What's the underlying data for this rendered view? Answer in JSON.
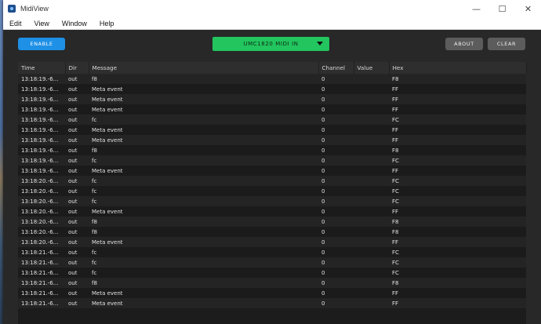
{
  "window": {
    "title": "MidiView"
  },
  "window_controls": {
    "minimize": "—",
    "maximize": "☐",
    "close": "✕"
  },
  "menu": [
    "Edit",
    "View",
    "Window",
    "Help"
  ],
  "toolbar": {
    "enable_label": "ENABLE",
    "device_label": "UMC1820 MIDI IN",
    "about_label": "ABOUT",
    "clear_label": "CLEAR"
  },
  "colors": {
    "enable": "#1e90e6",
    "device": "#22c55e",
    "background": "#282828"
  },
  "table": {
    "columns": [
      "Time",
      "Dir",
      "Message",
      "Channel",
      "Value",
      "Hex"
    ],
    "rows": [
      [
        "13:18:19.-6...",
        "out",
        "f8",
        "0",
        "",
        "F8"
      ],
      [
        "13:18:19.-6...",
        "out",
        "Meta event",
        "0",
        "",
        "FF"
      ],
      [
        "13:18:19.-6...",
        "out",
        "Meta event",
        "0",
        "",
        "FF"
      ],
      [
        "13:18:19.-6...",
        "out",
        "Meta event",
        "0",
        "",
        "FF"
      ],
      [
        "13:18:19.-6...",
        "out",
        "fc",
        "0",
        "",
        "FC"
      ],
      [
        "13:18:19.-6...",
        "out",
        "Meta event",
        "0",
        "",
        "FF"
      ],
      [
        "13:18:19.-6...",
        "out",
        "Meta event",
        "0",
        "",
        "FF"
      ],
      [
        "13:18:19.-6...",
        "out",
        "f8",
        "0",
        "",
        "F8"
      ],
      [
        "13:18:19.-6...",
        "out",
        "fc",
        "0",
        "",
        "FC"
      ],
      [
        "13:18:19.-6...",
        "out",
        "Meta event",
        "0",
        "",
        "FF"
      ],
      [
        "13:18:20.-6...",
        "out",
        "fc",
        "0",
        "",
        "FC"
      ],
      [
        "13:18:20.-6...",
        "out",
        "fc",
        "0",
        "",
        "FC"
      ],
      [
        "13:18:20.-6...",
        "out",
        "fc",
        "0",
        "",
        "FC"
      ],
      [
        "13:18:20.-6...",
        "out",
        "Meta event",
        "0",
        "",
        "FF"
      ],
      [
        "13:18:20.-6...",
        "out",
        "f8",
        "0",
        "",
        "F8"
      ],
      [
        "13:18:20.-6...",
        "out",
        "f8",
        "0",
        "",
        "F8"
      ],
      [
        "13:18:20.-6...",
        "out",
        "Meta event",
        "0",
        "",
        "FF"
      ],
      [
        "13:18:21.-6...",
        "out",
        "fc",
        "0",
        "",
        "FC"
      ],
      [
        "13:18:21.-6...",
        "out",
        "fc",
        "0",
        "",
        "FC"
      ],
      [
        "13:18:21.-6...",
        "out",
        "fc",
        "0",
        "",
        "FC"
      ],
      [
        "13:18:21.-6...",
        "out",
        "f8",
        "0",
        "",
        "F8"
      ],
      [
        "13:18:21.-6...",
        "out",
        "Meta event",
        "0",
        "",
        "FF"
      ],
      [
        "13:18:21.-6...",
        "out",
        "Meta event",
        "0",
        "",
        "FF"
      ]
    ]
  }
}
